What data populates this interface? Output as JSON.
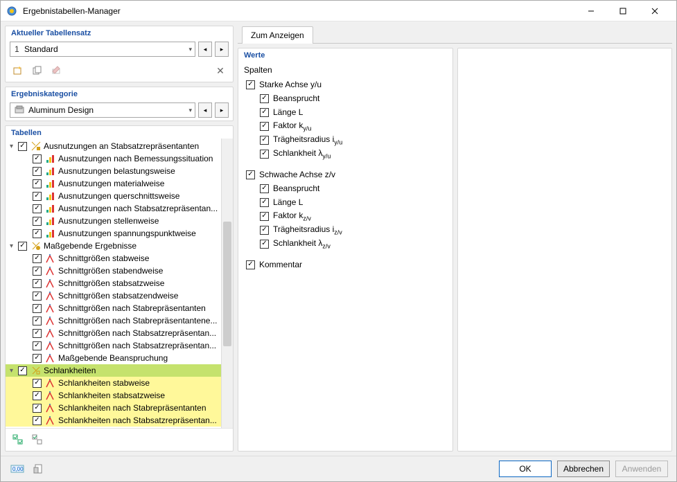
{
  "window": {
    "title": "Ergebnistabellen-Manager"
  },
  "section_tabset": {
    "header": "Aktueller Tabellensatz",
    "num": "1",
    "value": "Standard"
  },
  "section_category": {
    "header": "Ergebniskategorie",
    "value": "Aluminum Design"
  },
  "section_tables": {
    "header": "Tabellen"
  },
  "tree": [
    {
      "level": 0,
      "expanded": true,
      "label": "Ausnutzungen an Stabsatzrepräsentanten",
      "icon": "ratio-group"
    },
    {
      "level": 1,
      "label": "Ausnutzungen nach Bemessungssituation",
      "icon": "ratio-bars"
    },
    {
      "level": 1,
      "label": "Ausnutzungen belastungsweise",
      "icon": "ratio-bars"
    },
    {
      "level": 1,
      "label": "Ausnutzungen materialweise",
      "icon": "ratio-bars"
    },
    {
      "level": 1,
      "label": "Ausnutzungen querschnittsweise",
      "icon": "ratio-bars"
    },
    {
      "level": 1,
      "label": "Ausnutzungen nach Stabsatzrepräsentan...",
      "icon": "ratio-bars"
    },
    {
      "level": 1,
      "label": "Ausnutzungen stellenweise",
      "icon": "ratio-bars"
    },
    {
      "level": 1,
      "label": "Ausnutzungen spannungspunktweise",
      "icon": "ratio-bars"
    },
    {
      "level": 0,
      "expanded": true,
      "label": "Maßgebende Ergebnisse",
      "icon": "govern"
    },
    {
      "level": 1,
      "label": "Schnittgrößen stabweise",
      "icon": "force-red"
    },
    {
      "level": 1,
      "label": "Schnittgrößen stabendweise",
      "icon": "force-red"
    },
    {
      "level": 1,
      "label": "Schnittgrößen stabsatzweise",
      "icon": "force-red"
    },
    {
      "level": 1,
      "label": "Schnittgrößen stabsatzendweise",
      "icon": "force-red"
    },
    {
      "level": 1,
      "label": "Schnittgrößen nach Stabrepräsentanten",
      "icon": "force-red"
    },
    {
      "level": 1,
      "label": "Schnittgrößen nach Stabrepräsentantene...",
      "icon": "force-red"
    },
    {
      "level": 1,
      "label": "Schnittgrößen nach Stabsatzrepräsentan...",
      "icon": "force-red"
    },
    {
      "level": 1,
      "label": "Schnittgrößen nach Stabsatzrepräsentan...",
      "icon": "force-red"
    },
    {
      "level": 1,
      "label": "Maßgebende Beanspruchung",
      "icon": "force-red"
    },
    {
      "level": 0,
      "expanded": true,
      "label": "Schlankheiten",
      "icon": "slender",
      "hl": "green"
    },
    {
      "level": 1,
      "label": "Schlankheiten stabweise",
      "icon": "force-red",
      "hl": "yellow"
    },
    {
      "level": 1,
      "label": "Schlankheiten stabsatzweise",
      "icon": "force-red",
      "hl": "yellow"
    },
    {
      "level": 1,
      "label": "Schlankheiten nach Stabrepräsentanten",
      "icon": "force-red",
      "hl": "yellow"
    },
    {
      "level": 1,
      "label": "Schlankheiten nach Stabsatzrepräsentan...",
      "icon": "force-red",
      "hl": "yellow"
    }
  ],
  "right_tab": "Zum Anzeigen",
  "werte": {
    "header": "Werte",
    "spalten_label": "Spalten",
    "groups": [
      {
        "label": "Starke Achse y/u",
        "items": [
          {
            "label": "Beansprucht"
          },
          {
            "label": "Länge L"
          },
          {
            "label_html": "Faktor k<sub>y/u</sub>"
          },
          {
            "label_html": "Trägheitsradius i<sub>y/u</sub>"
          },
          {
            "label_html": "Schlankheit λ<sub>y/u</sub>"
          }
        ]
      },
      {
        "label": "Schwache Achse z/v",
        "items": [
          {
            "label": "Beansprucht"
          },
          {
            "label": "Länge L"
          },
          {
            "label_html": "Faktor k<sub>z/v</sub>"
          },
          {
            "label_html": "Trägheitsradius i<sub>z/v</sub>"
          },
          {
            "label_html": "Schlankheit λ<sub>z/v</sub>"
          }
        ]
      }
    ],
    "kommentar": "Kommentar"
  },
  "buttons": {
    "ok": "OK",
    "cancel": "Abbrechen",
    "apply": "Anwenden"
  }
}
